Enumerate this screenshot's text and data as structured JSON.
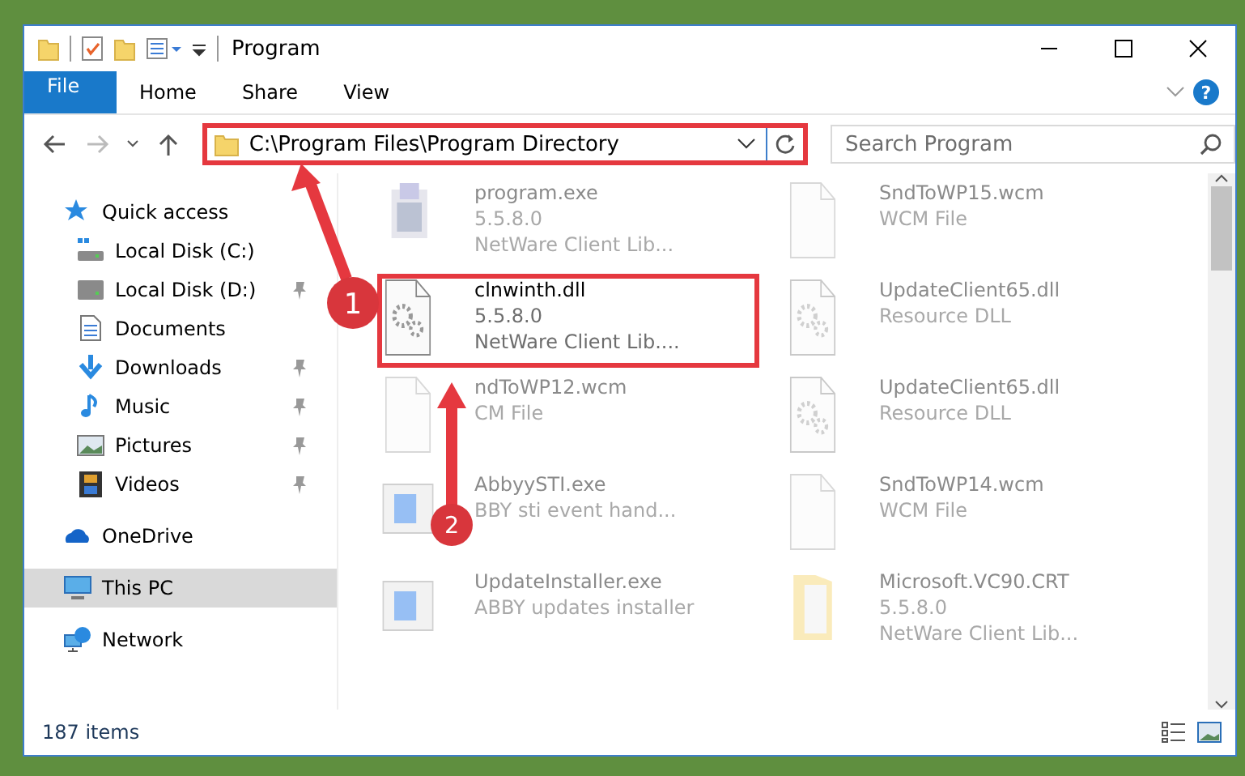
{
  "window": {
    "title": "Program"
  },
  "ribbon": {
    "tabs": [
      {
        "label": "File",
        "kind": "file"
      },
      {
        "label": "Home",
        "kind": "tab"
      },
      {
        "label": "Share",
        "kind": "tab"
      },
      {
        "label": "View",
        "kind": "tab"
      }
    ],
    "help": "?"
  },
  "address": {
    "path": "C:\\Program Files\\Program Directory",
    "highlighted": true
  },
  "search": {
    "placeholder": "Search Program"
  },
  "sidebar": {
    "items": [
      {
        "label": "Quick access",
        "kind": "star",
        "selected": false,
        "children": [
          {
            "label": "Local Disk (C:)",
            "kind": "system",
            "pinned": false
          },
          {
            "label": "Local Disk (D:)",
            "kind": "disk",
            "pinned": true
          },
          {
            "label": "Documents",
            "kind": "document",
            "pinned": false
          },
          {
            "label": "Downloads",
            "kind": "download",
            "pinned": true
          },
          {
            "label": "Music",
            "kind": "music",
            "pinned": true
          },
          {
            "label": "Pictures",
            "kind": "pictures",
            "pinned": true
          },
          {
            "label": "Videos",
            "kind": "videos",
            "pinned": true
          }
        ]
      },
      {
        "label": "OneDrive",
        "kind": "cloud",
        "selected": false
      },
      {
        "label": "This PC",
        "kind": "pc",
        "selected": true
      },
      {
        "label": "Network",
        "kind": "network",
        "selected": false
      }
    ]
  },
  "files": [
    {
      "kind": "exe",
      "lines": [
        "program.exe",
        "5.5.8.0",
        "NetWare Client Lib..."
      ],
      "faded": true,
      "highlighted": false
    },
    {
      "kind": "blank",
      "lines": [
        "SndToWP15.wcm",
        "WCM File"
      ],
      "faded": true,
      "highlighted": false
    },
    {
      "kind": "dll",
      "lines": [
        "clnwinth.dll",
        "5.5.8.0",
        "NetWare Client Lib...."
      ],
      "faded": false,
      "highlighted": true
    },
    {
      "kind": "dll",
      "lines": [
        "UpdateClient65.dll",
        "Resource DLL"
      ],
      "faded": true,
      "highlighted": false
    },
    {
      "kind": "blank",
      "lines": [
        "ndToWP12.wcm",
        "CM File"
      ],
      "faded": true,
      "highlighted": false
    },
    {
      "kind": "dll",
      "lines": [
        "UpdateClient65.dll",
        "Resource DLL"
      ],
      "faded": true,
      "highlighted": false
    },
    {
      "kind": "installer",
      "lines": [
        "AbbyySTI.exe",
        "BBY sti event hand..."
      ],
      "faded": true,
      "highlighted": false
    },
    {
      "kind": "blank",
      "lines": [
        "SndToWP14.wcm",
        "WCM File"
      ],
      "faded": true,
      "highlighted": false
    },
    {
      "kind": "installer",
      "lines": [
        "UpdateInstaller.exe",
        "ABBY updates installer"
      ],
      "faded": true,
      "highlighted": false
    },
    {
      "kind": "folder",
      "lines": [
        "Microsoft.VC90.CRT",
        "5.5.8.0",
        "NetWare Client Lib..."
      ],
      "faded": true,
      "highlighted": false
    }
  ],
  "annotations": [
    {
      "label": "1"
    },
    {
      "label": "2"
    }
  ],
  "status_bar": {
    "count": "187 items"
  }
}
